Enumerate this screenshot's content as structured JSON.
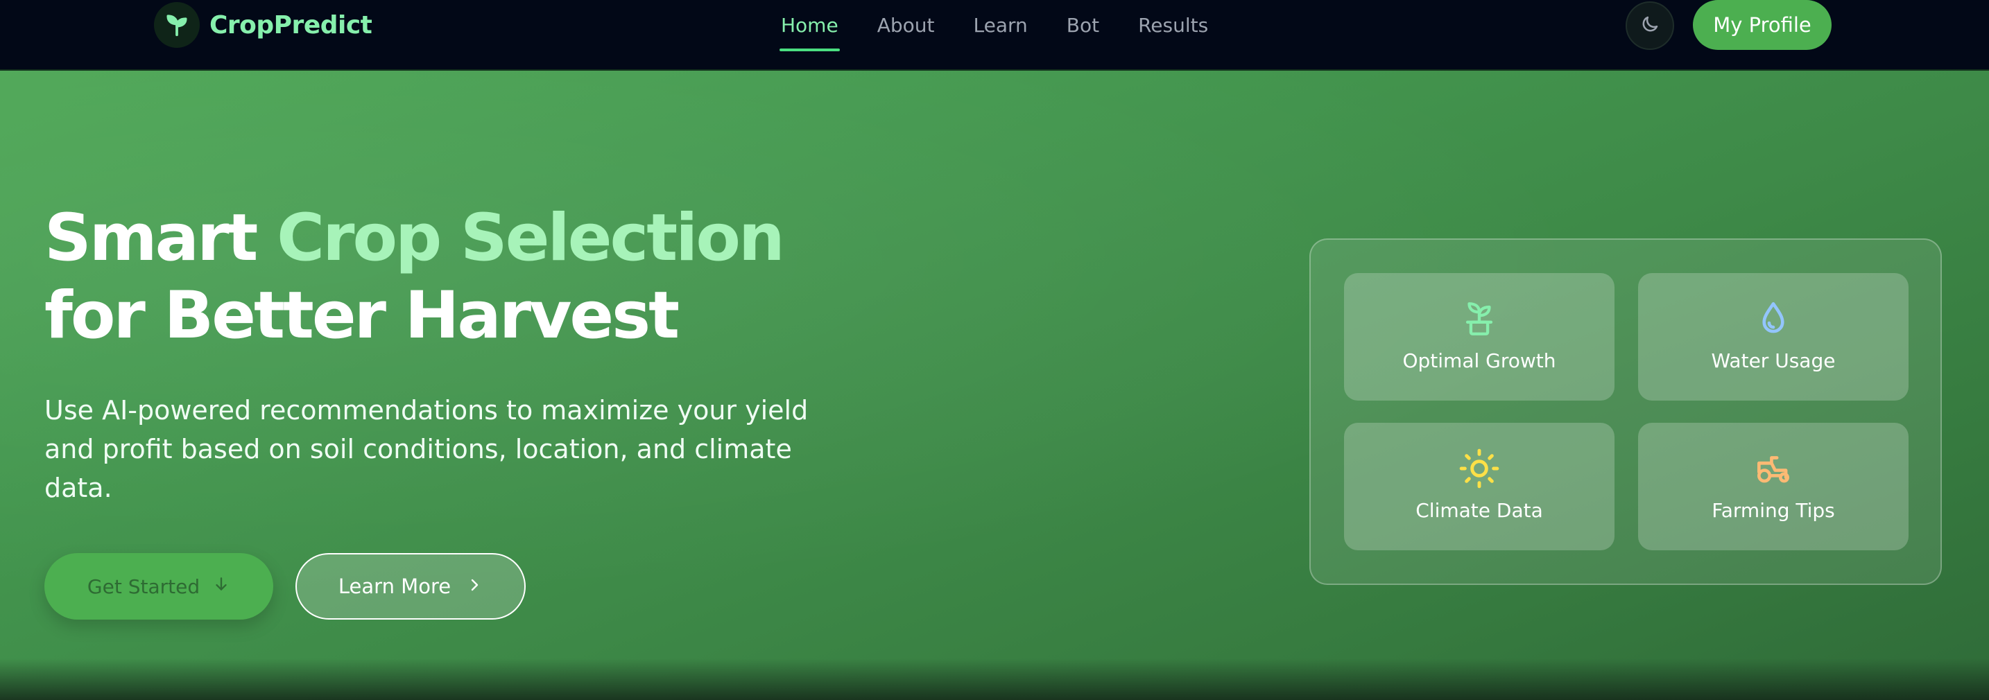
{
  "brand": {
    "name": "CropPredict",
    "logo_icon": "sprout-icon",
    "accent": "#86efac"
  },
  "nav": {
    "links": [
      {
        "label": "Home",
        "active": true
      },
      {
        "label": "About",
        "active": false
      },
      {
        "label": "Learn",
        "active": false
      },
      {
        "label": "Bot",
        "active": false
      },
      {
        "label": "Results",
        "active": false
      }
    ],
    "theme_toggle_icon": "moon-icon",
    "profile_label": "My Profile"
  },
  "hero": {
    "headline_part1": "Smart ",
    "headline_accent": "Crop Selection",
    "headline_part2": " for Better Harvest",
    "subtitle": "Use AI-powered recommendations to maximize your yield and profit based on soil conditions, location, and climate data.",
    "primary_button": {
      "label": "Get Started",
      "icon": "arrow-down-icon"
    },
    "secondary_button": {
      "label": "Learn More",
      "icon": "chevron-right-icon"
    }
  },
  "features": [
    {
      "label": "Optimal Growth",
      "icon": "sprout-pot-icon",
      "color": "#86efac"
    },
    {
      "label": "Water Usage",
      "icon": "droplet-icon",
      "color": "#93c5fd"
    },
    {
      "label": "Climate Data",
      "icon": "sun-icon",
      "color": "#fde047"
    },
    {
      "label": "Farming Tips",
      "icon": "tractor-icon",
      "color": "#fdba74"
    }
  ],
  "colors": {
    "nav_bg": "#020817",
    "primary_green": "#4caf50",
    "hero_green": "#459a50"
  }
}
